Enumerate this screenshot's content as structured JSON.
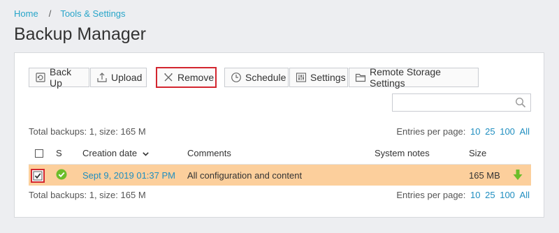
{
  "breadcrumb": {
    "home": "Home",
    "separator": "/",
    "tools": "Tools & Settings"
  },
  "page_title": "Backup Manager",
  "toolbar": {
    "backup_label": "Back Up",
    "upload_label": "Upload",
    "remove_label": "Remove",
    "schedule_label": "Schedule",
    "settings_label": "Settings",
    "remote_label": "Remote Storage Settings"
  },
  "search": {
    "placeholder": ""
  },
  "summary": {
    "top": "Total backups: 1, size: 165 M",
    "bottom": "Total backups: 1, size: 165 M"
  },
  "entries": {
    "label": "Entries per page:",
    "options": [
      "10",
      "25",
      "100",
      "All"
    ]
  },
  "table": {
    "headers": {
      "status": "S",
      "date": "Creation date",
      "comments": "Comments",
      "system": "System notes",
      "size": "Size"
    },
    "rows": [
      {
        "date": "Sept 9, 2019 01:37 PM",
        "comments": "All configuration and content",
        "system_notes": "",
        "size": "165 MB",
        "selected": true,
        "status": "ok"
      }
    ]
  },
  "colors": {
    "link": "#1f8ec0",
    "highlight": "#d3262f",
    "row_selected": "#fccf9c",
    "status_ok": "#6cbd2a"
  }
}
